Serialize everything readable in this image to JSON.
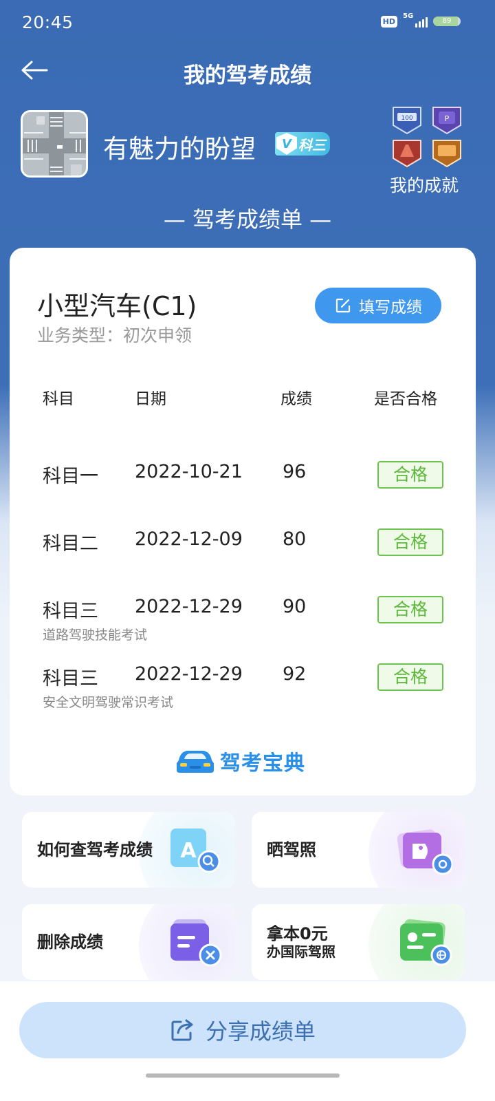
{
  "status": {
    "time": "20:45",
    "hd": "HD",
    "network": "5G",
    "battery": "89",
    "battery_level": 0.89
  },
  "header": {
    "title": "我的驾考成绩"
  },
  "profile": {
    "username": "有魅力的盼望",
    "level_badge": "科三",
    "achievements_label": "我的成就"
  },
  "section_title": "— 驾考成绩单 —",
  "card": {
    "vehicle": "小型汽车(C1)",
    "business_type": "业务类型：初次申领",
    "fill_button": "填写成绩",
    "columns": [
      "科目",
      "日期",
      "成绩",
      "是否合格"
    ],
    "rows": [
      {
        "subject": "科目一",
        "date": "2022-10-21",
        "score": "96",
        "result": "合格",
        "note": ""
      },
      {
        "subject": "科目二",
        "date": "2022-12-09",
        "score": "80",
        "result": "合格",
        "note": ""
      },
      {
        "subject": "科目三",
        "date": "2022-12-29",
        "score": "90",
        "result": "合格",
        "note": "道路驾驶技能考试"
      },
      {
        "subject": "科目三",
        "date": "2022-12-29",
        "score": "92",
        "result": "合格",
        "note": "安全文明驾驶常识考试"
      }
    ],
    "brand": "驾考宝典"
  },
  "tiles": [
    {
      "label": "如何查驾考成绩",
      "label2": "",
      "icon": "search-doc-icon"
    },
    {
      "label": "晒驾照",
      "label2": "",
      "icon": "photo-share-icon"
    },
    {
      "label": "删除成绩",
      "label2": "",
      "icon": "delete-doc-icon"
    },
    {
      "label": "拿本0元",
      "label2": "办国际驾照",
      "icon": "international-license-icon"
    }
  ],
  "share_button": "分享成绩单",
  "colors": {
    "header_bg": "#3a6bb4",
    "accent": "#3f97ee",
    "pass": "#5cb83a"
  }
}
